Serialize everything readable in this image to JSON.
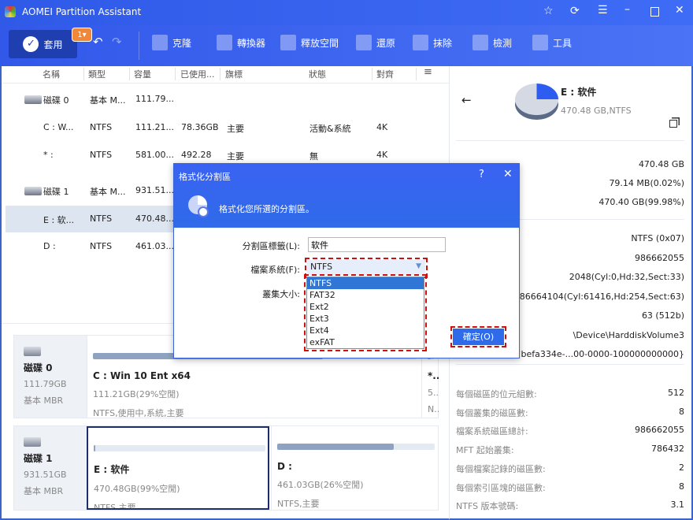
{
  "app": {
    "title": "AOMEI Partition Assistant"
  },
  "toolbar": {
    "apply": "套用",
    "pending": "1",
    "items": [
      "克隆",
      "轉換器",
      "釋放空間",
      "還原",
      "抹除",
      "檢測",
      "工具"
    ]
  },
  "columns": [
    "名稱",
    "類型",
    "容量",
    "已使用...",
    "旗標",
    "狀態",
    "對齊"
  ],
  "rows": [
    {
      "name": "磁碟 0",
      "type": "基本 M...",
      "cap": "111.79...",
      "used": "",
      "flag": "",
      "status": "",
      "align": "",
      "disk": true
    },
    {
      "name": "C : W...",
      "type": "NTFS",
      "cap": "111.21...",
      "used": "78.36GB",
      "flag": "主要",
      "status": "活動&系統",
      "align": "4K"
    },
    {
      "name": "* :",
      "type": "NTFS",
      "cap": "581.00...",
      "used": "492.28",
      "flag": "主要",
      "status": "無",
      "align": "4K"
    },
    {
      "name": "磁碟 1",
      "type": "基本 M...",
      "cap": "931.51...",
      "used": "",
      "flag": "",
      "status": "",
      "align": "",
      "disk": true
    },
    {
      "name": "E : 软...",
      "type": "NTFS",
      "cap": "470.48...",
      "used": "",
      "flag": "",
      "status": "",
      "align": ""
    },
    {
      "name": "D :",
      "type": "NTFS",
      "cap": "461.03...",
      "used": "",
      "flag": "",
      "status": "",
      "align": ""
    }
  ],
  "cards": [
    {
      "disk": "磁碟 0",
      "size": "111.79GB",
      "kind": "基本 MBR",
      "parts": [
        {
          "title": "C : Win 10 Ent x64",
          "size": "111.21GB(29%空閒)",
          "info": "NTFS,使用中,系統,主要",
          "used": 71
        },
        {
          "title": "*...",
          "size": "5...",
          "info": "N..",
          "used": 50
        }
      ]
    },
    {
      "disk": "磁碟 1",
      "size": "931.51GB",
      "kind": "基本 MBR",
      "parts": [
        {
          "title": "E : 软件",
          "size": "470.48GB(99%空閒)",
          "info": "NTFS,主要",
          "used": 1
        },
        {
          "title": "D :",
          "size": "461.03GB(26%空閒)",
          "info": "NTFS,主要",
          "used": 74
        }
      ]
    }
  ],
  "detail": {
    "title": "E : 软件",
    "subtitle": "470.48 GB,NTFS",
    "values1": [
      "470.48 GB",
      "79.14 MB(0.02%)",
      "470.40 GB(99.98%)"
    ],
    "values2": [
      "NTFS (0x07)",
      "986662055",
      "2048(Cyl:0,Hd:32,Sect:33)",
      "986664104(Cyl:61416,Hd:254,Sect:63)",
      "63 (512b)",
      "\\Device\\HarddiskVolume3",
      "lume{befa334e-...00-0000-100000000000}"
    ],
    "stats": [
      {
        "k": "每個磁區的位元組數:",
        "v": "512"
      },
      {
        "k": "每個叢集的磁區數:",
        "v": "8"
      },
      {
        "k": "檔案系統磁區總計:",
        "v": "986662055"
      },
      {
        "k": "MFT 起始叢集:",
        "v": "786432"
      },
      {
        "k": "每個檔案記錄的磁區數:",
        "v": "2"
      },
      {
        "k": "每個索引區塊的磁區數:",
        "v": "8"
      },
      {
        "k": "NTFS 版本號碼:",
        "v": "3.1"
      }
    ]
  },
  "dialog": {
    "title": "格式化分割區",
    "help": "?",
    "desc": "格式化您所選的分割區。",
    "label_label": "分割區標籤(L):",
    "label_value": "软件",
    "fs_label": "檔案系統(F):",
    "fs_value": "NTFS",
    "cluster_label": "叢集大小:",
    "fs_options": [
      "NTFS",
      "FAT32",
      "Ext2",
      "Ext3",
      "Ext4",
      "exFAT"
    ],
    "ok": "確定(O)"
  },
  "colors": {
    "accent": "#3a62f0",
    "selected": "#dde5f0",
    "highlight": "#cc1010"
  }
}
